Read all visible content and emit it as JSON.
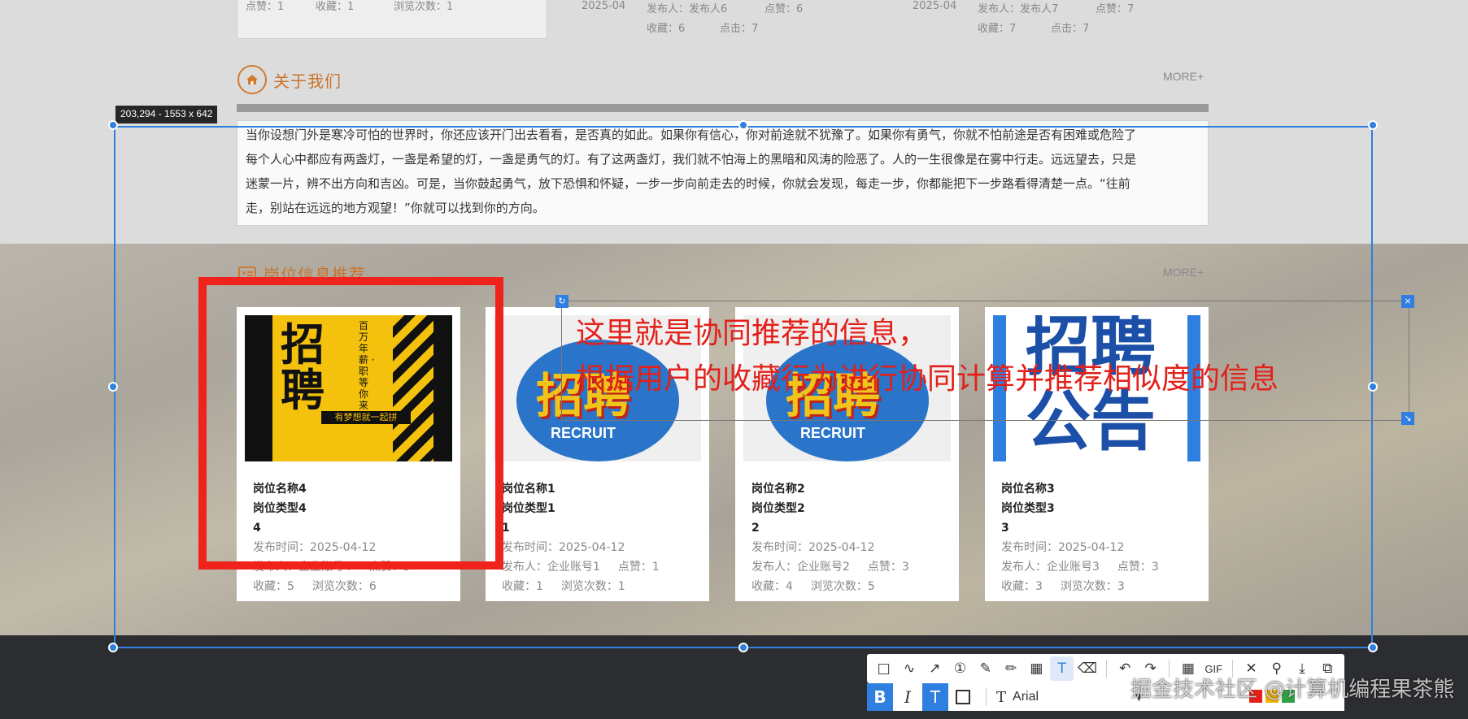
{
  "top_cards": {
    "left": {
      "likes": "点赞：1",
      "fav": "收藏：1",
      "views": "浏览次数：1"
    },
    "mid": {
      "date": "2025-04",
      "publisher": "发布人：发布人6",
      "likes": "点赞：6",
      "fav": "收藏：6",
      "views": "点击：7"
    },
    "right": {
      "date": "2025-04",
      "publisher": "发布人：发布人7",
      "likes": "点赞：7",
      "fav": "收藏：7",
      "views": "点击：7"
    }
  },
  "about": {
    "title": "关于我们",
    "more": "MORE+",
    "lines": [
      "当你设想门外是寒冷可怕的世界时，你还应该开门出去看看，是否真的如此。如果你有信心，你对前途就不犹豫了。如果你有勇气，你就不怕前途是否有困难或危险了",
      "每个人心中都应有两盏灯，一盏是希望的灯，一盏是勇气的灯。有了这两盏灯，我们就不怕海上的黑暗和风涛的险恶了。人的一生很像是在雾中行走。远远望去，只是",
      "迷蒙一片，辨不出方向和吉凶。可是，当你鼓起勇气，放下恐惧和怀疑，一步一步向前走去的时候，你就会发现，每走一步，你都能把下一步路看得清楚一点。“往前",
      "走，别站在远远的地方观望！”你就可以找到你的方向。"
    ]
  },
  "recommend": {
    "title": "岗位信息推荐",
    "more": "MORE+",
    "cards": [
      {
        "name": "岗位名称4",
        "type": "岗位类型4",
        "num": "4",
        "time": "发布时间：2025-04-12",
        "publisher": "发布人：企业账号4",
        "likes": "点赞：5",
        "fav": "收藏：5",
        "views": "浏览次数：6",
        "poster": "yellow"
      },
      {
        "name": "岗位名称1",
        "type": "岗位类型1",
        "num": "1",
        "time": "发布时间：2025-04-12",
        "publisher": "发布人：企业账号1",
        "likes": "点赞：1",
        "fav": "收藏：1",
        "views": "浏览次数：1",
        "poster": "recruit"
      },
      {
        "name": "岗位名称2",
        "type": "岗位类型2",
        "num": "2",
        "time": "发布时间：2025-04-12",
        "publisher": "发布人：企业账号2",
        "likes": "点赞：3",
        "fav": "收藏：4",
        "views": "浏览次数：5",
        "poster": "recruit"
      },
      {
        "name": "岗位名称3",
        "type": "岗位类型3",
        "num": "3",
        "time": "发布时间：2025-04-12",
        "publisher": "发布人：企业账号3",
        "likes": "点赞：3",
        "fav": "收藏：3",
        "views": "浏览次数：3",
        "poster": "notice"
      }
    ],
    "poster_text": {
      "yellow_big": "招聘",
      "yellow_side": "百万年薪 · 职等你来",
      "yellow_bottom": "有梦想就一起拼",
      "recruit_big": "招聘",
      "recruit_sub": "RECRUIT",
      "notice_top": "招聘",
      "notice_bottom": "公告"
    }
  },
  "capture": {
    "size_tip": "203,294 - 1553 x 642",
    "annotation_line1": "这里就是协同推荐的信息，",
    "annotation_line2": "根据用户的收藏行为进行协同计算并推荐相似度的信息",
    "font_name": "Arial",
    "gif_label": "GIF",
    "watermark": "掘金技术社区 @计算机编程果茶熊",
    "color_accent": "#2f7fe0",
    "color_mark": "#f0231c"
  }
}
